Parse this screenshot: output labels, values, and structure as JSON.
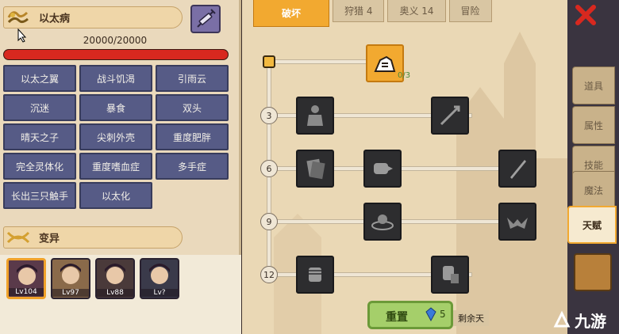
{
  "disease": {
    "name": "以太病",
    "hp_text": "20000/20000",
    "hp_fraction": 1.0
  },
  "traits": [
    "以太之翼",
    "战斗饥渴",
    "引雨云",
    "沉迷",
    "暴食",
    "双头",
    "晴天之子",
    "尖刺外壳",
    "重度肥胖",
    "完全灵体化",
    "重度嗜血症",
    "多手症",
    "长出三只触手",
    "以太化"
  ],
  "mutation": {
    "title": "变异",
    "avatars": [
      {
        "level": "Lv104",
        "selected": true
      },
      {
        "level": "Lv97",
        "selected": false
      },
      {
        "level": "Lv88",
        "selected": false
      },
      {
        "level": "Lv?",
        "selected": false
      }
    ]
  },
  "tabs": [
    "破坏",
    "狩猎 4",
    "奥义 14",
    "冒险"
  ],
  "active_tab": "破坏",
  "talent_tree": {
    "root_count": "0/3",
    "levels": [
      "3",
      "6",
      "9",
      "12"
    ],
    "nodes": {
      "r3": [
        "brute-icon",
        "arrow-spike-icon"
      ],
      "r6": [
        "shield-cards-icon",
        "punch-icon",
        "blade-icon"
      ],
      "r9": [
        "ripple-orb-icon",
        "bat-wing-icon"
      ],
      "r12": [
        "fist-icon",
        "fist-slam-icon"
      ]
    }
  },
  "reset_button": {
    "label": "重置",
    "gem_count": "5"
  },
  "remaining_label": "剩余天",
  "side_tabs": [
    "道具",
    "属性",
    "技能",
    "魔法",
    "天赋"
  ],
  "active_side_tab": "天赋",
  "brand": "九游",
  "colors": {
    "accent": "#f2a930",
    "trait_bg": "#565b86",
    "hp": "#d8281f",
    "reset": "#a5cf6a"
  }
}
